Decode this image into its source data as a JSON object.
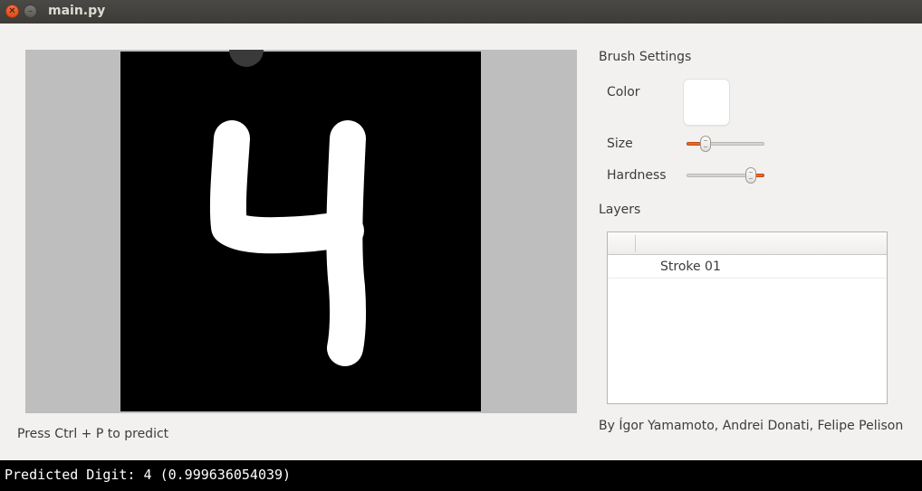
{
  "window": {
    "title": "main.py",
    "close_icon": "close-icon",
    "minimize_icon": "minimize-icon"
  },
  "canvas": {
    "background_color": "#000000",
    "border_color": "#bebebe",
    "stroke_color": "#ffffff",
    "drawn_digit": "4"
  },
  "hint": "Press Ctrl + P to predict",
  "brush": {
    "title": "Brush Settings",
    "color_label": "Color",
    "color_value": "#ffffff",
    "size_label": "Size",
    "size_value": 0.2,
    "hardness_label": "Hardness",
    "hardness_value": 0.88
  },
  "layers": {
    "title": "Layers",
    "items": [
      {
        "name": "Stroke 01"
      }
    ]
  },
  "credits": "By Ígor Yamamoto, Andrei Donati, Felipe Pelison",
  "terminal": {
    "output": "Predicted Digit: 4 (0.999636054039)"
  },
  "accent_color": "#e8672a"
}
